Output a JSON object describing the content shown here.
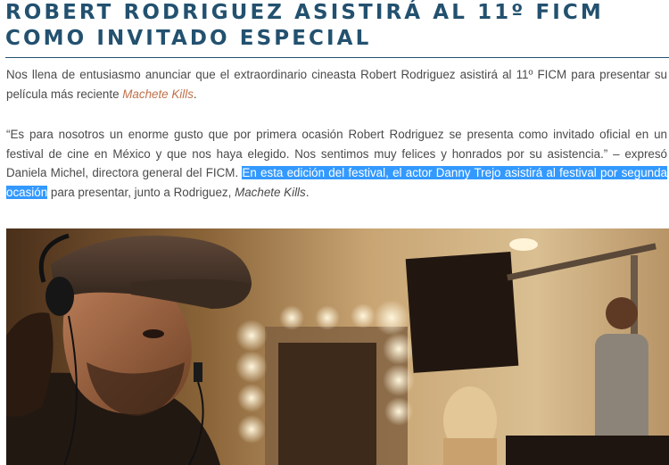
{
  "article": {
    "headline": "ROBERT RODRIGUEZ ASISTIRÁ AL 11º FICM COMO INVITADO ESPECIAL",
    "intro": {
      "text_before": "Nos llena de entusiasmo anunciar que el extraordinario cineasta Robert Rodriguez asistirá al 11º FICM para presentar su película más reciente ",
      "film_link": "Machete Kills",
      "text_after": "."
    },
    "quote": {
      "text_quote": "“Es para nosotros un enorme gusto que por primera ocasión Robert Rodriguez se presenta como invitado oficial en un festival de cine en México y que nos haya elegido. Nos sentimos muy felices y honrados por su asistencia.” – expresó Daniela Michel, directora general del FICM. ",
      "text_selected": "En esta edición del festival, el actor Danny Trejo asistirá al festival por segunda ocasión",
      "text_after": " para presentar, junto a Rodriguez, ",
      "film_title": "Machete Kills",
      "text_end": "."
    }
  },
  "colors": {
    "headline": "#23516f",
    "body_text": "#4a4a4a",
    "link": "#c0714a",
    "selection": "#3399ff"
  }
}
